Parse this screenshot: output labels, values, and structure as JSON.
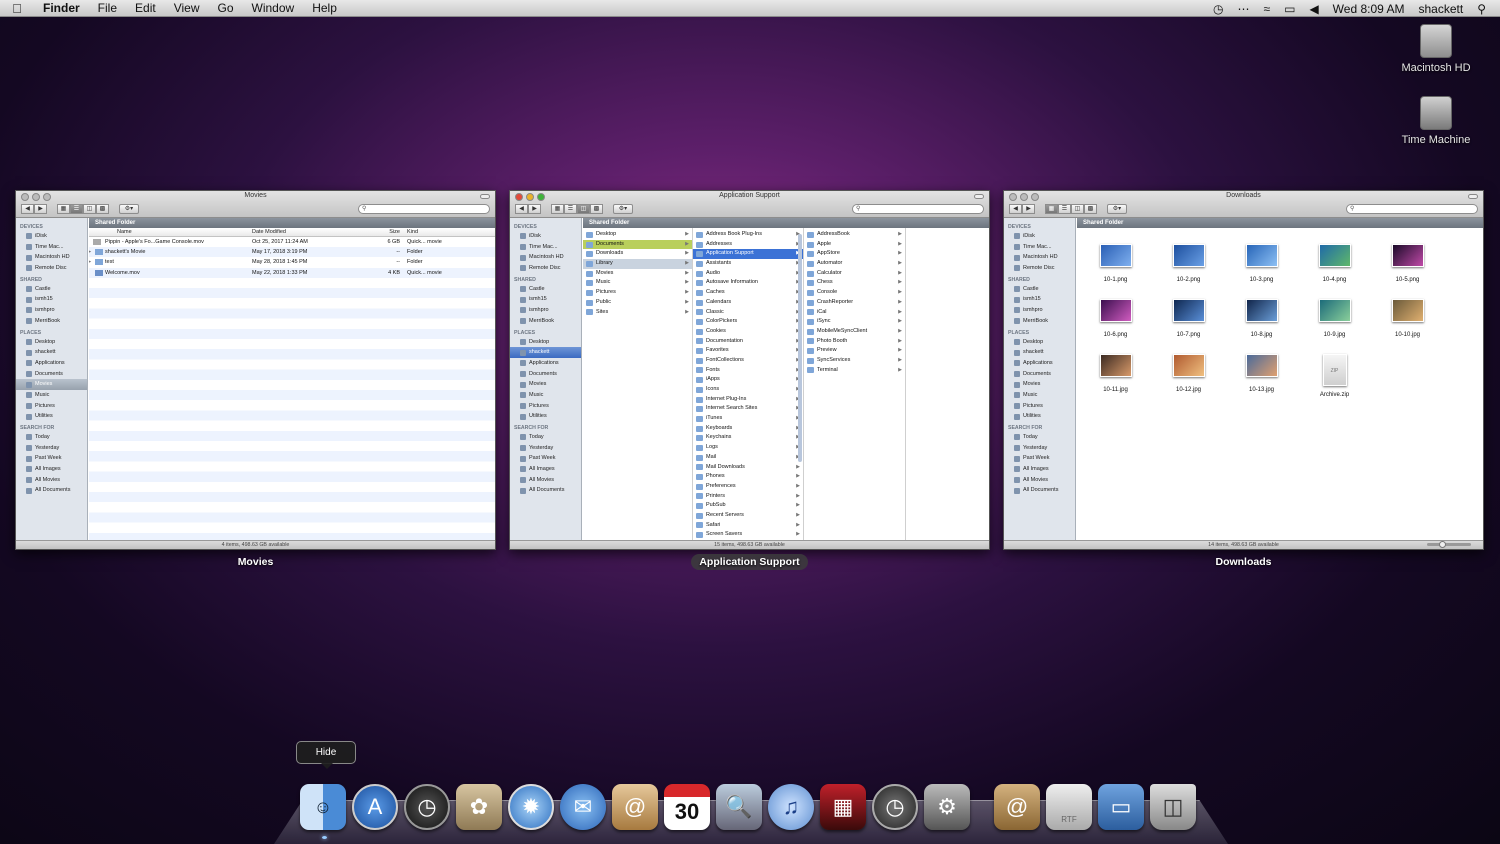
{
  "menubar": {
    "app": "Finder",
    "items": [
      "File",
      "Edit",
      "View",
      "Go",
      "Window",
      "Help"
    ],
    "clock": "Wed 8:09 AM",
    "user": "shackett"
  },
  "desktop": {
    "icons": [
      "Macintosh HD",
      "Time Machine"
    ]
  },
  "sidebar": {
    "devices_header": "DEVICES",
    "devices": [
      "iDisk",
      "Time Mac...",
      "Macintosh HD",
      "Remote Disc"
    ],
    "shared_header": "SHARED",
    "shared": [
      "Castle",
      "ismh15",
      "ismhpro",
      "MerriBook"
    ],
    "places_header": "PLACES",
    "places": [
      "Desktop",
      "shackett",
      "Applications",
      "Documents",
      "Movies",
      "Music",
      "Pictures",
      "Utilities"
    ],
    "search_header": "SEARCH FOR",
    "search": [
      "Today",
      "Yesterday",
      "Past Week",
      "All Images",
      "All Movies",
      "All Documents"
    ]
  },
  "shared_folder": "Shared Folder",
  "windows": {
    "movies": {
      "title": "Movies",
      "label": "Movies",
      "status": "4 items, 498.63 GB available",
      "columns": [
        "Name",
        "Date Modified",
        "Size",
        "Kind"
      ],
      "rows": [
        [
          "Pippin - Apple's Fo...Game Console.mov",
          "Oct 25, 2017 11:24 AM",
          "6 GB",
          "Quick... movie"
        ],
        [
          "shackett's Movie",
          "May 17, 2018 3:19 PM",
          "--",
          "Folder"
        ],
        [
          "test",
          "May 28, 2018 1:45 PM",
          "--",
          "Folder"
        ],
        [
          "Welcome.mov",
          "May 22, 2018 1:33 PM",
          "4 KB",
          "Quick... movie"
        ]
      ]
    },
    "appsupport": {
      "title": "Application Support",
      "label": "Application Support",
      "status": "15 items, 498.63 GB available",
      "col1": [
        "Desktop",
        "Documents",
        "Downloads",
        "Library",
        "Movies",
        "Music",
        "Pictures",
        "Public",
        "Sites"
      ],
      "col2": [
        "Address Book Plug-Ins",
        "Addresses",
        "Application Support",
        "Assistants",
        "Audio",
        "Autosave Information",
        "Caches",
        "Calendars",
        "Classic",
        "ColorPickers",
        "Cookies",
        "Documentation",
        "Favorites",
        "FontCollections",
        "Fonts",
        "iApps",
        "Icons",
        "Internet Plug-Ins",
        "Internet Search Sites",
        "iTunes",
        "Keyboards",
        "Keychains",
        "Logs",
        "Mail",
        "Mail Downloads",
        "Phones",
        "Preferences",
        "Printers",
        "PubSub",
        "Recent Servers",
        "Safari",
        "Screen Savers"
      ],
      "col3": [
        "AddressBook",
        "Apple",
        "AppStore",
        "Automator",
        "Calculator",
        "Chess",
        "Console",
        "CrashReporter",
        "iCal",
        "iSync",
        "MobileMeSyncClient",
        "Photo Booth",
        "Preview",
        "SyncServices",
        "Terminal"
      ]
    },
    "downloads": {
      "title": "Downloads",
      "label": "Downloads",
      "status": "14 items, 498.63 GB available",
      "files": [
        "10-1.png",
        "10-2.png",
        "10-3.png",
        "10-4.png",
        "10-5.png",
        "10-6.png",
        "10-7.png",
        "10-8.jpg",
        "10-9.jpg",
        "10-10.jpg",
        "10-11.jpg",
        "10-12.jpg",
        "10-13.jpg",
        "Archive.zip"
      ]
    }
  },
  "tooltip": "Hide",
  "calendar_day": "30",
  "rtf": "RTF",
  "zip_label": "ZIP",
  "colors": {
    "selection": "#3b72d6",
    "sidebar": "#e0e5ec"
  }
}
